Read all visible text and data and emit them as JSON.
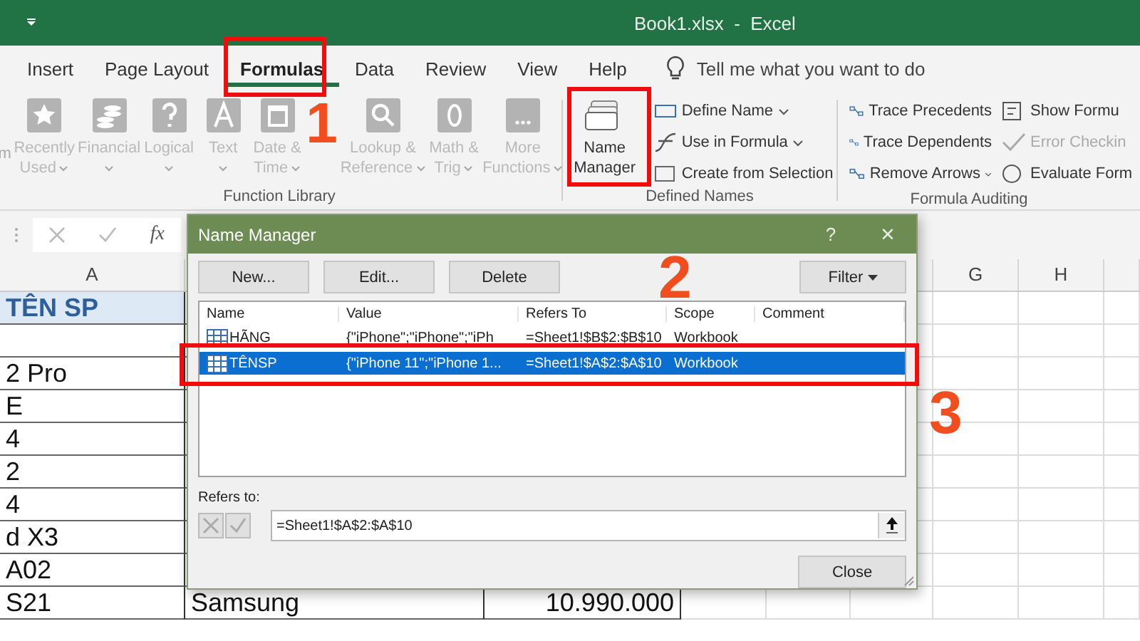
{
  "window": {
    "title": "Book1.xlsx  -  Excel"
  },
  "ribbon_tabs": [
    {
      "label": "Insert",
      "selected": false
    },
    {
      "label": "Page Layout",
      "selected": false
    },
    {
      "label": "Formulas",
      "selected": true
    },
    {
      "label": "Data",
      "selected": false
    },
    {
      "label": "Review",
      "selected": false
    },
    {
      "label": "View",
      "selected": false
    },
    {
      "label": "Help",
      "selected": false
    }
  ],
  "tell_me": {
    "placeholder": "Tell me what you want to do"
  },
  "function_library": {
    "cut_label": "m",
    "label": "Function Library",
    "buttons": [
      {
        "lines": [
          "Recently",
          "Used"
        ],
        "caret": true,
        "disabled": true
      },
      {
        "lines": [
          "Financial"
        ],
        "caret": true,
        "disabled": true
      },
      {
        "lines": [
          "Logical"
        ],
        "caret": true,
        "disabled": true
      },
      {
        "lines": [
          "Text"
        ],
        "caret": true,
        "disabled": true
      },
      {
        "lines": [
          "Date &",
          "Time"
        ],
        "caret": true,
        "disabled": true
      },
      {
        "lines": [
          "Lookup &",
          "Reference"
        ],
        "caret": true,
        "disabled": true
      },
      {
        "lines": [
          "Math &",
          "Trig"
        ],
        "caret": true,
        "disabled": true
      },
      {
        "lines": [
          "More",
          "Functions"
        ],
        "caret": true,
        "disabled": true
      }
    ]
  },
  "defined_names": {
    "label": "Defined Names",
    "big_button": {
      "lines": [
        "Name",
        "Manager"
      ]
    },
    "items": [
      {
        "label": "Define Name",
        "caret": true
      },
      {
        "label": "Use in Formula",
        "caret": true
      },
      {
        "label": "Create from Selection",
        "caret": false
      }
    ]
  },
  "formula_auditing": {
    "label": "Formula Auditing",
    "items": [
      {
        "label": "Trace Precedents",
        "caret": false,
        "disabled": false
      },
      {
        "label": "Trace Dependents",
        "caret": false,
        "disabled": false
      },
      {
        "label": "Remove Arrows",
        "caret": true,
        "disabled": false
      },
      {
        "label": "Show Formu",
        "caret": false,
        "disabled": false
      },
      {
        "label": "Error Checkin",
        "caret": false,
        "disabled": true
      },
      {
        "label": "Evaluate Form",
        "caret": false,
        "disabled": false
      }
    ]
  },
  "formula_bar": {
    "function_label": "fx"
  },
  "sheet": {
    "columns": [
      {
        "label": "A"
      },
      {
        "label": "G"
      },
      {
        "label": "H"
      }
    ],
    "rows": [
      {
        "col_a": "TÊN SP",
        "kind": "header"
      },
      {
        "kind": "data"
      },
      {
        "col_a": "2 Pro",
        "kind": "data"
      },
      {
        "col_a": "E",
        "kind": "data"
      },
      {
        "col_a": "4",
        "kind": "data"
      },
      {
        "col_a": "2",
        "kind": "data"
      },
      {
        "col_a": "4",
        "kind": "data"
      },
      {
        "col_a": "d X3",
        "kind": "data"
      },
      {
        "col_a": "A02",
        "kind": "data"
      },
      {
        "col_a": "S21",
        "col_b": "Samsung",
        "col_c": "10.990.000",
        "kind": "data"
      }
    ]
  },
  "dialog": {
    "title": "Name Manager",
    "help": "?",
    "close": "×",
    "buttons": [
      "New...",
      "Edit...",
      "Delete"
    ],
    "filter": "Filter",
    "columns": [
      "Name",
      "Value",
      "Refers To",
      "Scope",
      "Comment"
    ],
    "rows": [
      {
        "name": "HÃNG",
        "value": "{\"iPhone\";\"iPhone\";\"iPh",
        "refers_to": "=Sheet1!$B$2:$B$10",
        "scope": "Workbook",
        "selected": false
      },
      {
        "name": "TÊNSP",
        "value": "{\"iPhone 11\";\"iPhone 1...",
        "refers_to": "=Sheet1!$A$2:$A$10",
        "scope": "Workbook",
        "selected": true
      }
    ],
    "refers_label": "Refers to:",
    "refers_value": "=Sheet1!$A$2:$A$10",
    "close_button": "Close"
  },
  "annotations": [
    {
      "number": "1"
    },
    {
      "number": "2"
    },
    {
      "number": "3"
    }
  ]
}
